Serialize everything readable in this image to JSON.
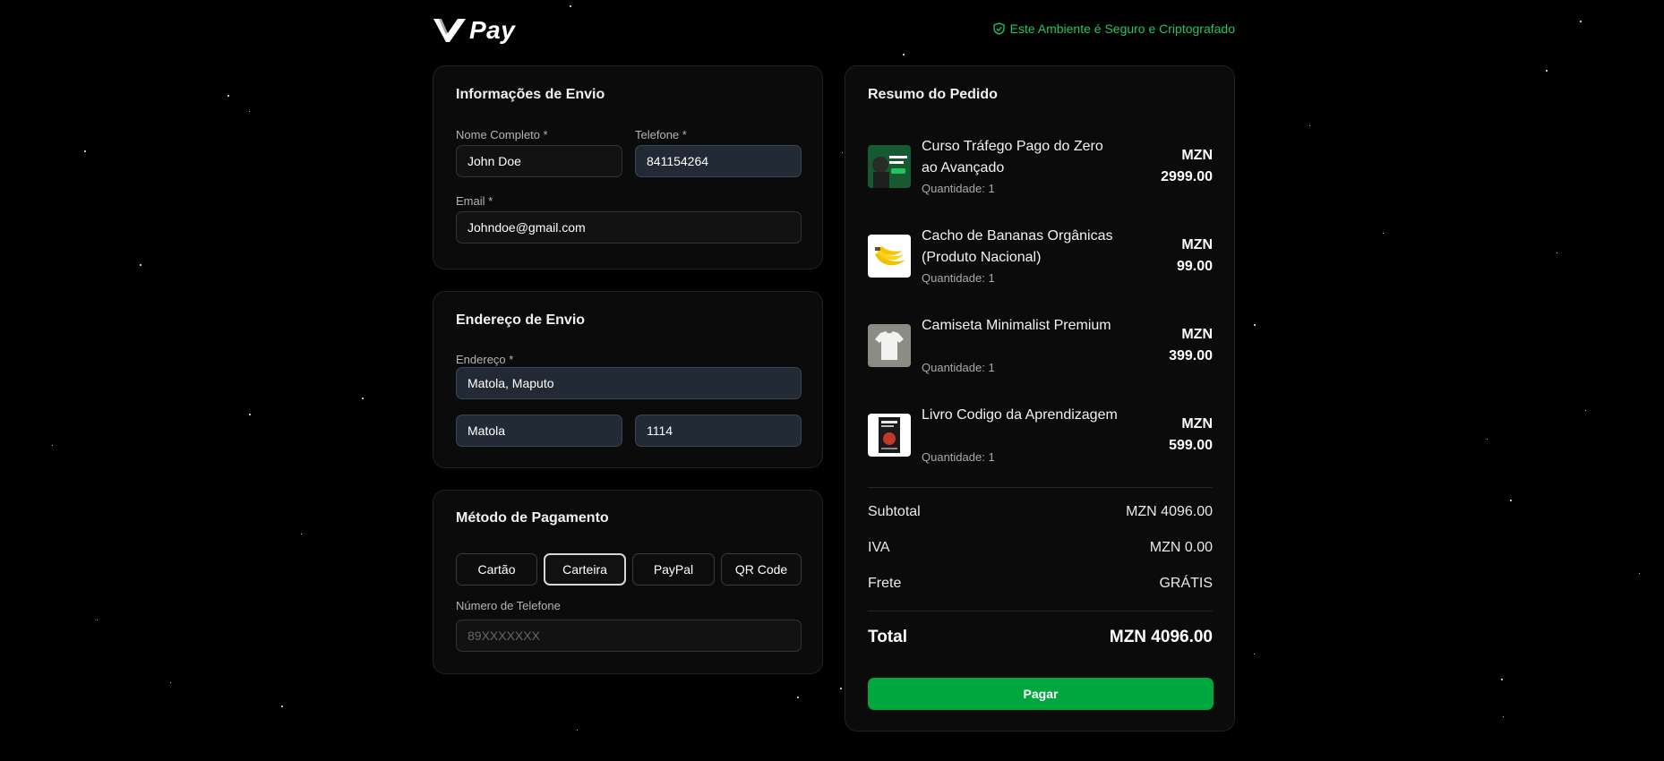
{
  "brand": {
    "name": "Pay"
  },
  "secure_notice": "Este Ambiente é Seguro e Criptografado",
  "shipping_info": {
    "title": "Informações de Envio",
    "name_label": "Nome Completo *",
    "name_value": "John Doe",
    "phone_label": "Telefone *",
    "phone_value": "841154264",
    "email_label": "Email *",
    "email_value": "Johndoe@gmail.com"
  },
  "shipping_address": {
    "title": "Endereço de Envio",
    "address_label": "Endereço *",
    "address_value": "Matola, Maputo",
    "city_value": "Matola",
    "zip_value": "1114"
  },
  "payment": {
    "title": "Método de Pagamento",
    "methods": [
      "Cartão",
      "Carteira",
      "PayPal",
      "QR Code"
    ],
    "selected": "Carteira",
    "phone_label": "Número de Telefone",
    "phone_placeholder": "89XXXXXXX"
  },
  "summary": {
    "title": "Resumo do Pedido",
    "items": [
      {
        "name": "Curso Tráfego Pago do Zero ao Avançado",
        "qty": "Quantidade: 1",
        "currency": "MZN",
        "price": "2999.00"
      },
      {
        "name": "Cacho de Bananas Orgânicas (Produto Nacional)",
        "qty": "Quantidade: 1",
        "currency": "MZN",
        "price": "99.00"
      },
      {
        "name": "Camiseta Minimalist Premium",
        "qty": "Quantidade: 1",
        "currency": "MZN",
        "price": "399.00"
      },
      {
        "name": "Livro Codigo da Aprendizagem",
        "qty": "Quantidade: 1",
        "currency": "MZN",
        "price": "599.00"
      }
    ],
    "subtotal_label": "Subtotal",
    "subtotal_value": "MZN 4096.00",
    "tax_label": "IVA",
    "tax_value": "MZN 0.00",
    "shipping_label": "Frete",
    "shipping_value": "GRÁTIS",
    "total_label": "Total",
    "total_value": "MZN 4096.00",
    "pay_label": "Pagar"
  },
  "colors": {
    "accent_green": "#00a63e",
    "secure_green": "#22c55e",
    "background": "#000000"
  }
}
